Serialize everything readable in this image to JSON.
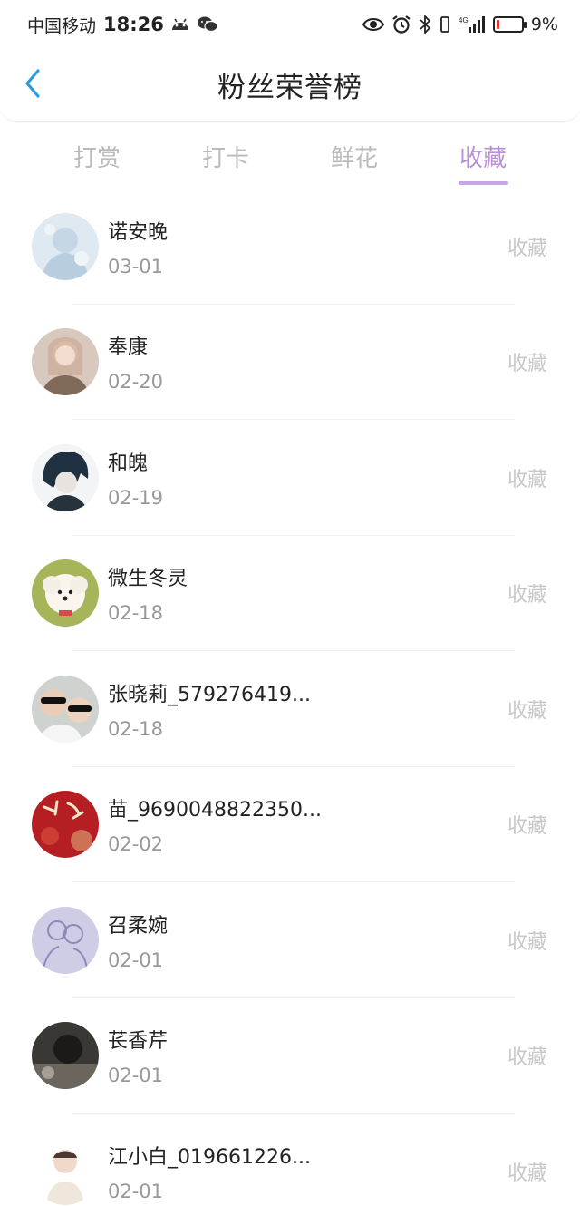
{
  "status_bar": {
    "carrier": "中国移动",
    "time": "18:26",
    "network": "4G",
    "battery_percent": "9%",
    "battery_level": 0.09,
    "battery_color": "#e0332e",
    "icons": [
      "android-icon",
      "wechat-icon",
      "eye-icon",
      "alarm-icon",
      "bluetooth-icon",
      "vibrate-icon",
      "signal-icon",
      "battery-icon"
    ]
  },
  "header": {
    "title": "粉丝荣誉榜",
    "back_icon": "chevron-left-icon",
    "back_color": "#2a9be2"
  },
  "tabs": [
    {
      "label": "打赏",
      "active": false
    },
    {
      "label": "打卡",
      "active": false
    },
    {
      "label": "鲜花",
      "active": false
    },
    {
      "label": "收藏",
      "active": true
    }
  ],
  "accent_color": "#b98fd6",
  "list": [
    {
      "name": "诺安晚",
      "date": "03-01",
      "action": "收藏",
      "avatar": "pale-blue-illustration"
    },
    {
      "name": "奉康",
      "date": "02-20",
      "action": "收藏",
      "avatar": "woman-portrait"
    },
    {
      "name": "和魄",
      "date": "02-19",
      "action": "收藏",
      "avatar": "anime-boy"
    },
    {
      "name": "微生冬灵",
      "date": "02-18",
      "action": "收藏",
      "avatar": "white-puppy"
    },
    {
      "name": "张晓莉_579276419...",
      "date": "02-18",
      "action": "收藏",
      "avatar": "couple-selfie"
    },
    {
      "name": "苗_9690048822350...",
      "date": "02-02",
      "action": "收藏",
      "avatar": "red-calligraphy"
    },
    {
      "name": "召柔婉",
      "date": "02-01",
      "action": "收藏",
      "avatar": "lavender-sketch"
    },
    {
      "name": "苌香芹",
      "date": "02-01",
      "action": "收藏",
      "avatar": "dark-photo"
    },
    {
      "name": "江小白_019661226...",
      "date": "02-01",
      "action": "收藏",
      "avatar": "baby-portrait"
    }
  ]
}
